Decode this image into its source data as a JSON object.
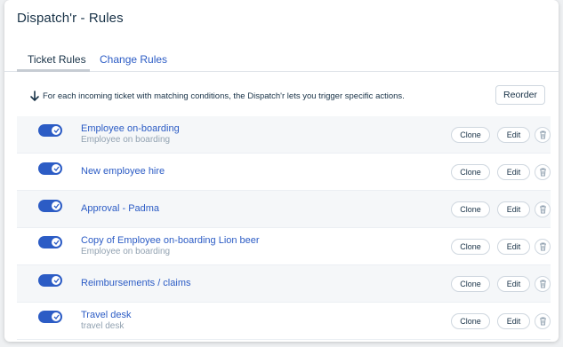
{
  "page": {
    "title": "Dispatch'r - Rules"
  },
  "tabs": [
    {
      "label": "Ticket Rules",
      "active": true
    },
    {
      "label": "Change Rules",
      "active": false
    }
  ],
  "info_text": "For each incoming ticket with matching conditions, the Dispatch'r lets you trigger specific actions.",
  "reorder_label": "Reorder",
  "actions": {
    "clone": "Clone",
    "edit": "Edit"
  },
  "rules": [
    {
      "name": "Employee on-boarding",
      "description": "Employee on boarding",
      "enabled": true
    },
    {
      "name": "New employee hire",
      "description": "",
      "enabled": true
    },
    {
      "name": "Approval - Padma",
      "description": "",
      "enabled": true
    },
    {
      "name": "Copy of Employee on-boarding Lion beer",
      "description": "Employee on boarding",
      "enabled": true
    },
    {
      "name": "Reimbursements / claims",
      "description": "",
      "enabled": true
    },
    {
      "name": "Travel desk",
      "description": "travel desk",
      "enabled": true
    }
  ]
}
